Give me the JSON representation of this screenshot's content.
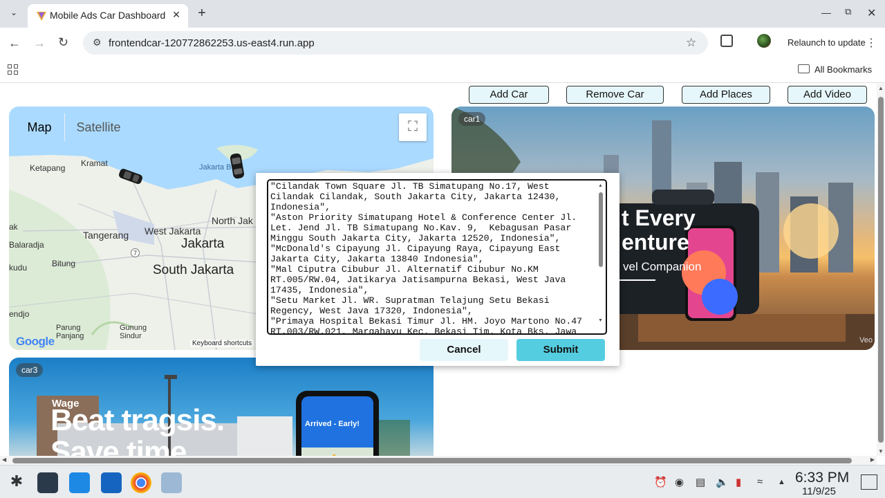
{
  "browser": {
    "tab_title": "Mobile Ads Car Dashboard",
    "url": "frontendcar-120772862253.us-east4.run.app",
    "relaunch_label": "Relaunch to update",
    "bookmarks_label": "All Bookmarks"
  },
  "toolbar_buttons": {
    "add_car": "Add Car",
    "remove_car": "Remove Car",
    "add_places": "Add Places",
    "add_video": "Add Video"
  },
  "map": {
    "map_label": "Map",
    "satellite_label": "Satellite",
    "keyboard_shortcuts": "Keyboard shortcuts",
    "google": "Google",
    "places": {
      "ketapang": "Ketapang",
      "kramat": "Kramat",
      "jakarta_bay": "Jakarta B",
      "west_jakarta": "West Jakarta",
      "north_jak": "North Jak",
      "tangerang": "Tangerang",
      "jakarta": "Jakarta",
      "south_jakarta": "South Jakarta",
      "bitung": "Bitung",
      "kudu": "kudu",
      "ak": "ak",
      "balaradja": "Balaradja",
      "endjo": "endjo",
      "parung_panjang": "Parung\nPanjang",
      "gunung_sindur": "Gunung\nSindur",
      "route_no": "7"
    }
  },
  "cars": {
    "car1_label": "car1",
    "car3_label": "car3",
    "car1_ad_line1": "t Every",
    "car1_ad_line2": "enture",
    "car1_ad_line3": "vel Companion",
    "car1_watermark": "Veo",
    "car3_ad_line1": "Beat tragsis.",
    "car3_ad_line2": "Save time",
    "car3_store": "Wage",
    "car3_phone_text": "Arrived - Early!"
  },
  "dialog": {
    "addresses": "\"Cilandak Town Square Jl. TB Simatupang No.17, West\nCilandak Cilandak, South Jakarta City, Jakarta 12430,\nIndonesia\",\n\"Aston Priority Simatupang Hotel & Conference Center Jl.\nLet. Jend Jl. TB Simatupang No.Kav. 9,  Kebagusan Pasar\nMinggu South Jakarta City, Jakarta 12520, Indonesia\",\n\"McDonald's Cipayung Jl. Cipayung Raya, Cipayung East\nJakarta City, Jakarta 13840 Indonesia\",\n\"Mal Ciputra Cibubur Jl. Alternatif Cibubur No.KM\nRT.005/RW.04, Jatikarya Jatisampurna Bekasi, West Java\n17435, Indonesia\",\n\"Setu Market Jl. WR. Supratman Telajung Setu Bekasi\nRegency, West Java 17320, Indonesia\",\n\"Primaya Hospital Bekasi Timur Jl. HM. Joyo Martono No.47\nRT.003/RW.021, Margahayu Kec. Bekasi Tim. Kota Bks. Jawa",
    "cancel_label": "Cancel",
    "submit_label": "Submit"
  },
  "taskbar": {
    "time": "6:33 PM",
    "date": "11/9/25"
  },
  "colors": {
    "button_bg": "#e6f7fb",
    "submit_bg": "#55cde0",
    "water": "#aadaff"
  }
}
